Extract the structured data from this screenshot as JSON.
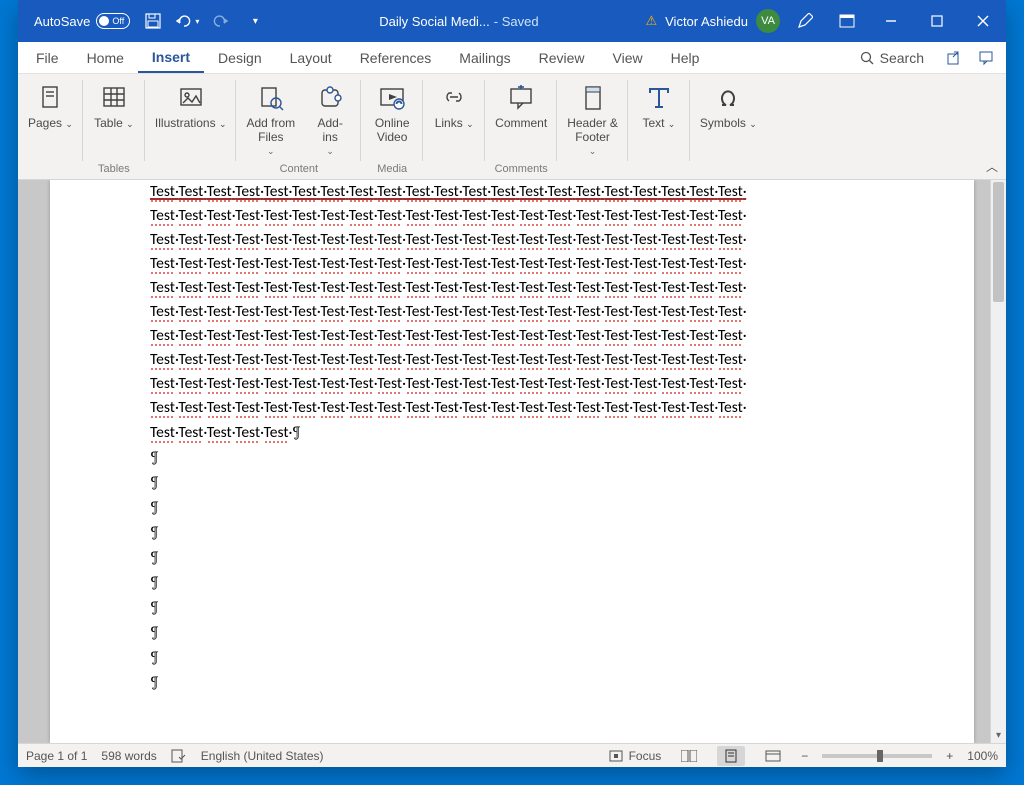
{
  "titlebar": {
    "autosave_label": "AutoSave",
    "autosave_state": "Off",
    "doc_name": "Daily Social Medi...",
    "saved_label": "- Saved",
    "user_name": "Victor Ashiedu",
    "user_initials": "VA"
  },
  "menu": {
    "items": [
      "File",
      "Home",
      "Insert",
      "Design",
      "Layout",
      "References",
      "Mailings",
      "Review",
      "View",
      "Help"
    ],
    "active_index": 2,
    "search_label": "Search"
  },
  "ribbon": {
    "groups": [
      {
        "label": "",
        "buttons": [
          {
            "label": "Pages",
            "dropdown": true
          }
        ]
      },
      {
        "label": "Tables",
        "buttons": [
          {
            "label": "Table",
            "dropdown": true
          }
        ]
      },
      {
        "label": "",
        "buttons": [
          {
            "label": "Illustrations",
            "dropdown": true
          }
        ]
      },
      {
        "label": "Content",
        "buttons": [
          {
            "label": "Add from Files",
            "dropdown": true
          },
          {
            "label": "Add-ins",
            "dropdown": true
          }
        ]
      },
      {
        "label": "Media",
        "buttons": [
          {
            "label": "Online Video",
            "dropdown": false
          }
        ]
      },
      {
        "label": "",
        "buttons": [
          {
            "label": "Links",
            "dropdown": true
          }
        ]
      },
      {
        "label": "Comments",
        "buttons": [
          {
            "label": "Comment",
            "dropdown": false
          }
        ]
      },
      {
        "label": "",
        "buttons": [
          {
            "label": "Header & Footer",
            "dropdown": true
          }
        ]
      },
      {
        "label": "",
        "buttons": [
          {
            "label": "Text",
            "dropdown": true
          }
        ]
      },
      {
        "label": "",
        "buttons": [
          {
            "label": "Symbols",
            "dropdown": true
          }
        ]
      }
    ]
  },
  "document": {
    "repeated_word": "Test",
    "full_lines": 10,
    "words_per_full_line": 21,
    "last_line_words": 5,
    "paragraph_marks": 10
  },
  "statusbar": {
    "page": "Page 1 of 1",
    "words": "598 words",
    "language": "English (United States)",
    "focus": "Focus",
    "zoom": "100%"
  }
}
